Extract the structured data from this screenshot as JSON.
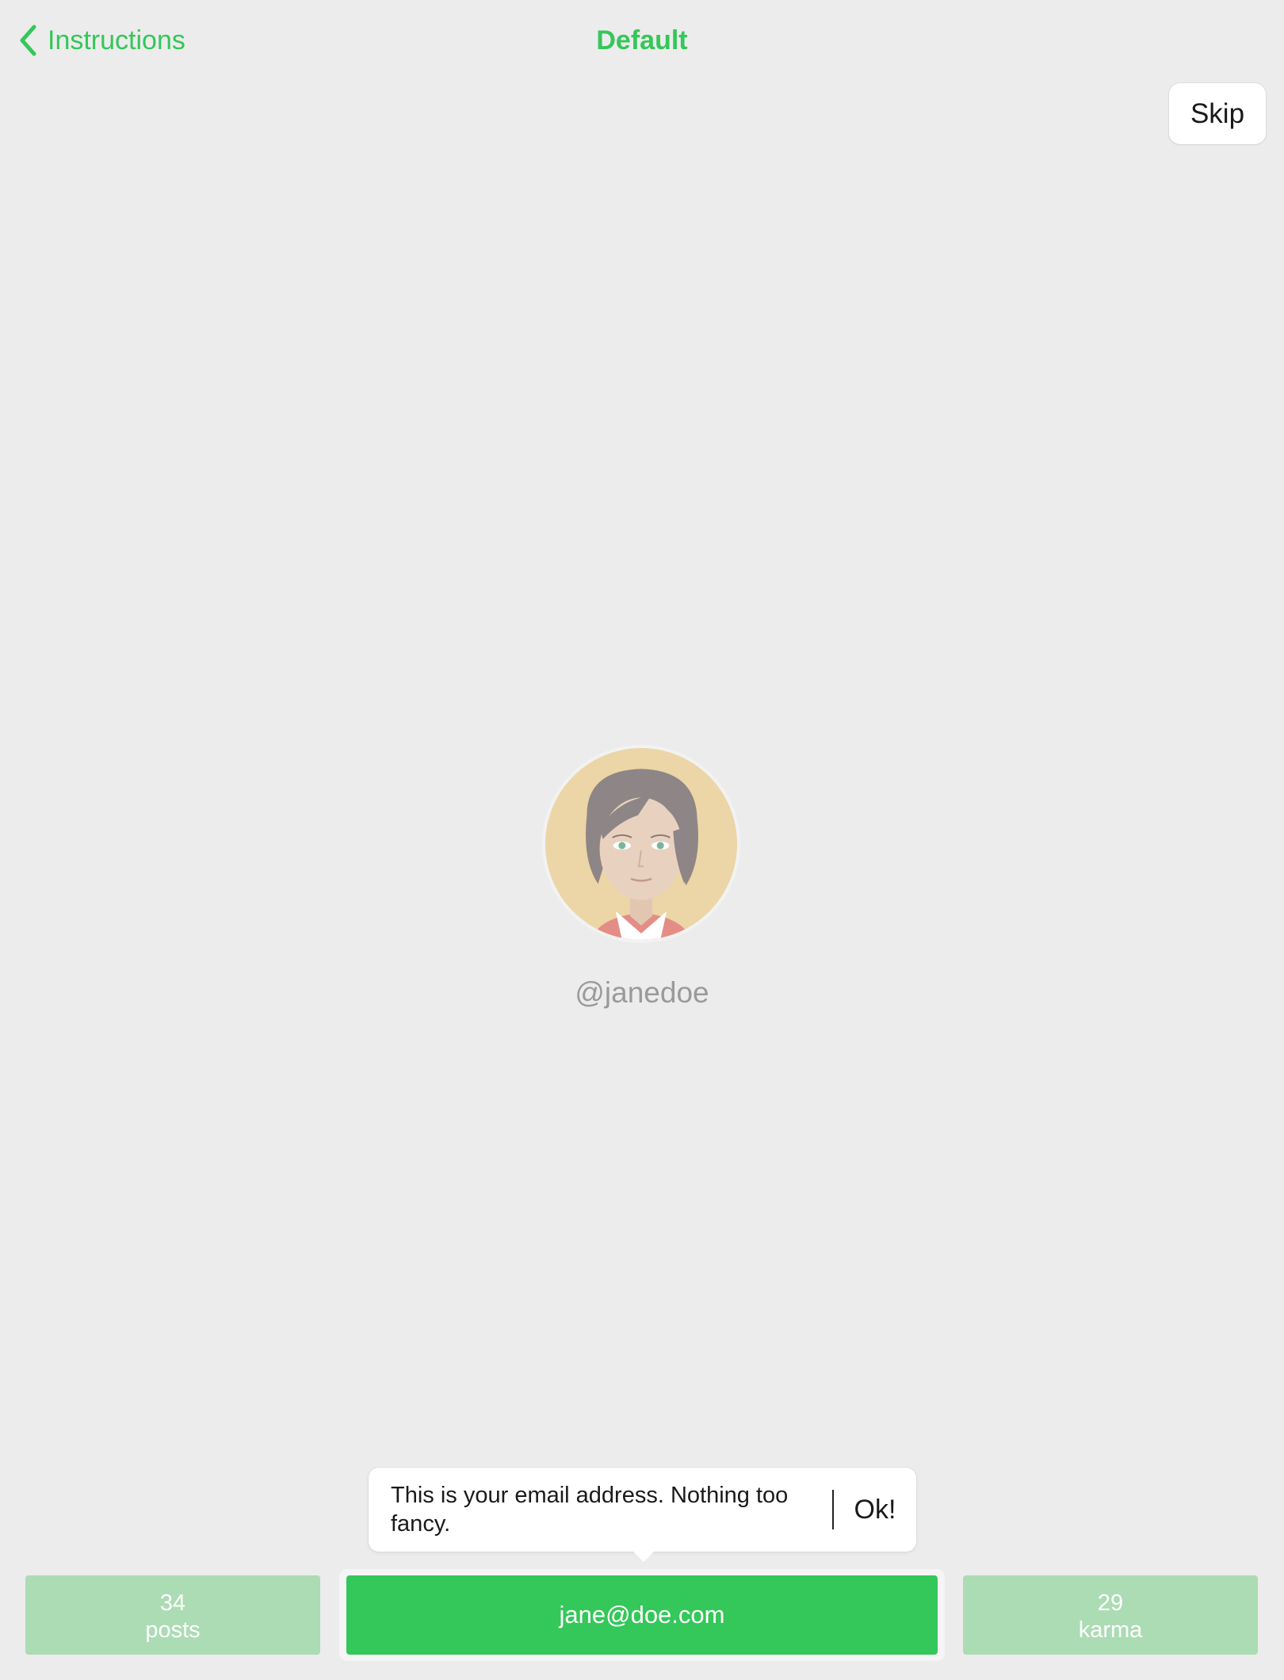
{
  "nav": {
    "back_label": "Instructions",
    "title": "Default"
  },
  "skip_label": "Skip",
  "profile": {
    "username": "@janedoe"
  },
  "tooltip": {
    "message": "This is your email address. Nothing too fancy.",
    "ok_label": "Ok!"
  },
  "stats": {
    "posts": {
      "value": "34",
      "label": "posts"
    },
    "email": "jane@doe.com",
    "karma": {
      "value": "29",
      "label": "karma"
    }
  },
  "colors": {
    "accent": "#34c759",
    "accent_dimmed": "#abdcb4",
    "background": "#ececec"
  }
}
